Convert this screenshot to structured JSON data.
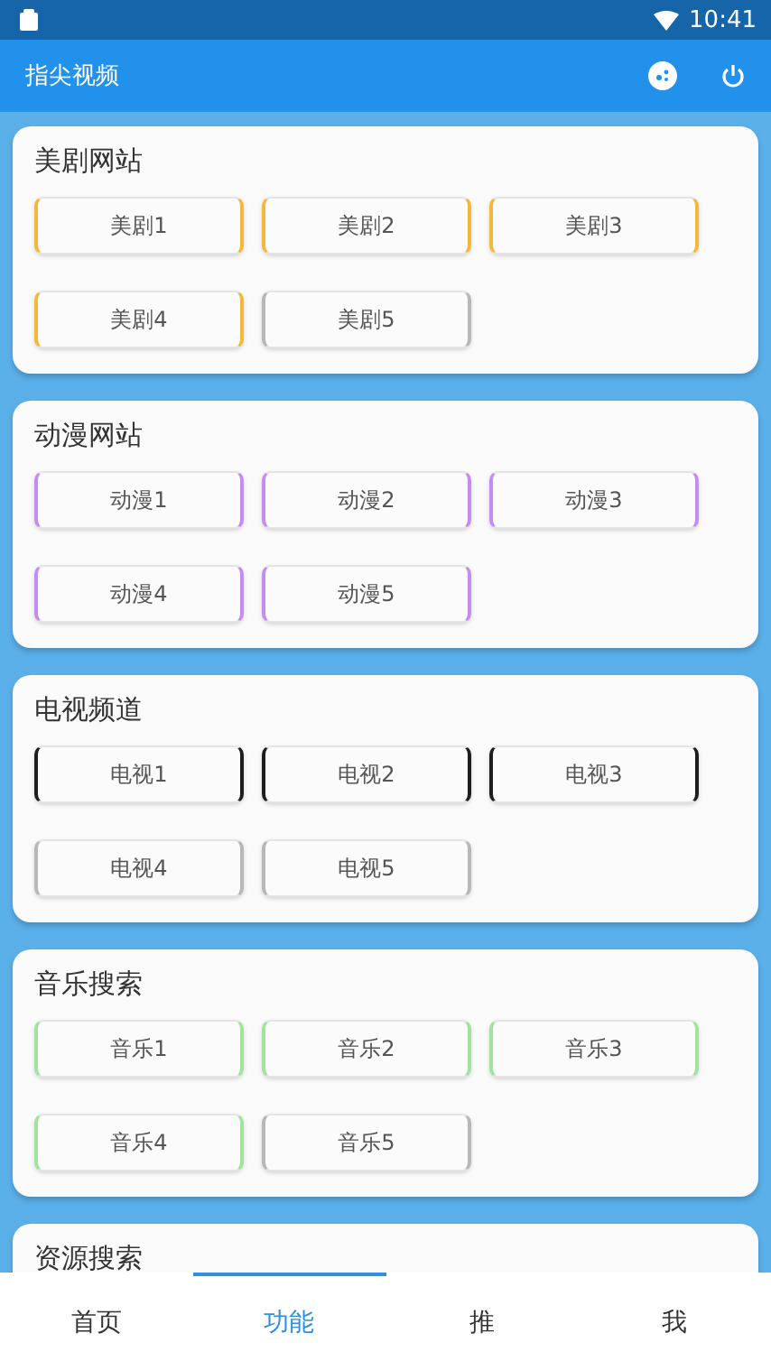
{
  "status_bar": {
    "time": "10:41"
  },
  "app_bar": {
    "title": "指尖视频"
  },
  "sections": [
    {
      "title": "美剧网站",
      "buttons": [
        {
          "label": "美剧1",
          "color": "#f3b83a"
        },
        {
          "label": "美剧2",
          "color": "#f3b83a"
        },
        {
          "label": "美剧3",
          "color": "#f3b83a"
        },
        {
          "label": "美剧4",
          "color": "#f3b83a"
        },
        {
          "label": "美剧5",
          "color": "#b8b8b8"
        }
      ]
    },
    {
      "title": "动漫网站",
      "buttons": [
        {
          "label": "动漫1",
          "color": "#c48cf2"
        },
        {
          "label": "动漫2",
          "color": "#c48cf2"
        },
        {
          "label": "动漫3",
          "color": "#c48cf2"
        },
        {
          "label": "动漫4",
          "color": "#c48cf2"
        },
        {
          "label": "动漫5",
          "color": "#c48cf2"
        }
      ]
    },
    {
      "title": "电视频道",
      "buttons": [
        {
          "label": "电视1",
          "color": "#1e1e1e"
        },
        {
          "label": "电视2",
          "color": "#1e1e1e"
        },
        {
          "label": "电视3",
          "color": "#1e1e1e"
        },
        {
          "label": "电视4",
          "color": "#b8b8b8"
        },
        {
          "label": "电视5",
          "color": "#b8b8b8"
        }
      ]
    },
    {
      "title": "音乐搜索",
      "buttons": [
        {
          "label": "音乐1",
          "color": "#9fe39f"
        },
        {
          "label": "音乐2",
          "color": "#9fe39f"
        },
        {
          "label": "音乐3",
          "color": "#9fe39f"
        },
        {
          "label": "音乐4",
          "color": "#9fe39f"
        },
        {
          "label": "音乐5",
          "color": "#b8b8b8"
        }
      ]
    },
    {
      "title": "资源搜索"
    }
  ],
  "bottom_nav": [
    {
      "label": "首页",
      "selected": false
    },
    {
      "label": "功能",
      "selected": true
    },
    {
      "label": "推",
      "selected": false
    },
    {
      "label": "我",
      "selected": false
    }
  ]
}
